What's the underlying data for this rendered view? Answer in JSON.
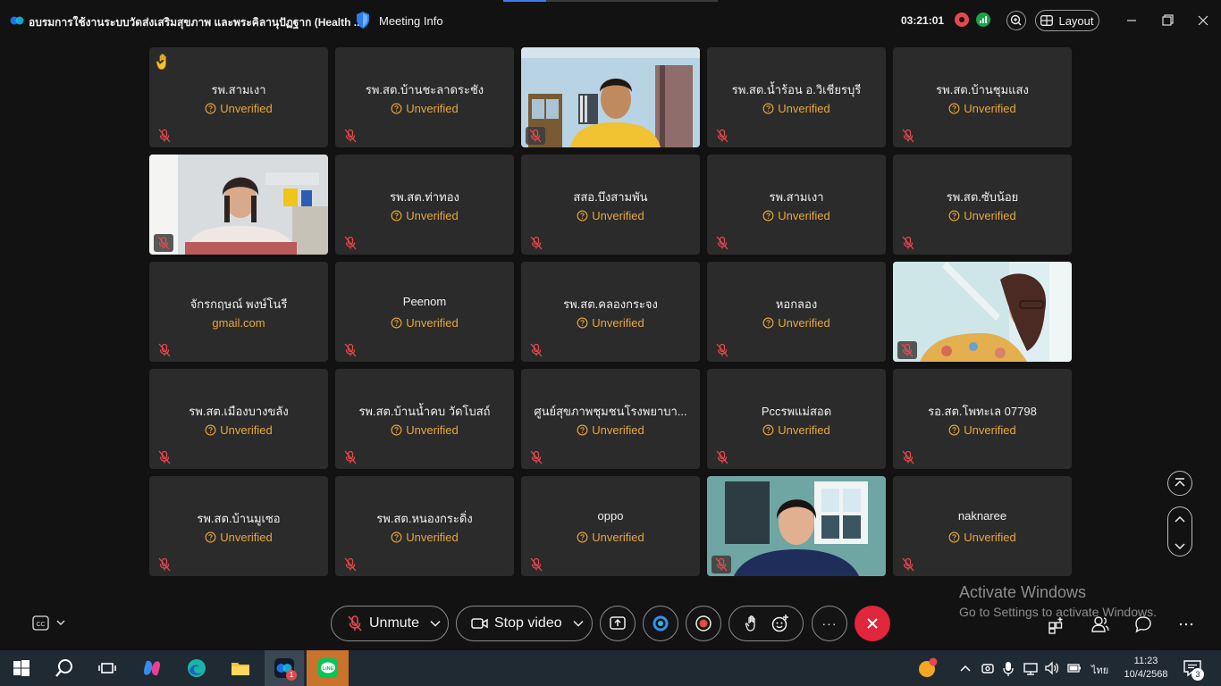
{
  "titlebar": {
    "meeting_title": "อบรมการใช้งานระบบวัดส่งเสริมสุขภาพ และพระคิลานุปัฏฐาก (Health ...",
    "meeting_info": "Meeting Info",
    "timer": "03:21:01",
    "layout_label": "Layout"
  },
  "tiles": [
    {
      "name": "รพ.สามเงา",
      "status": "Unverified",
      "hand": true
    },
    {
      "name": "รพ.สต.บ้านชะลาดระชัง",
      "status": "Unverified"
    },
    {
      "video": true
    },
    {
      "name": "รพ.สต.น้ำร้อน อ.วิเชียรบุรี",
      "status": "Unverified"
    },
    {
      "name": "รพ.สต.บ้านชุมแสง",
      "status": "Unverified"
    },
    {
      "video": true
    },
    {
      "name": "รพ.สต.ท่าทอง",
      "status": "Unverified"
    },
    {
      "name": "สสอ.บึงสามพัน",
      "status": "Unverified"
    },
    {
      "name": "รพ.สามเงา",
      "status": "Unverified"
    },
    {
      "name": "รพ.สต.ซับน้อย",
      "status": "Unverified"
    },
    {
      "name": "จักรกฤษณ์ พงษ์โนรี",
      "status": "gmail.com",
      "plain": true
    },
    {
      "name": "Peenom",
      "status": "Unverified"
    },
    {
      "name": "รพ.สต.คลองกระจง",
      "status": "Unverified"
    },
    {
      "name": "หอกลอง",
      "status": "Unverified"
    },
    {
      "video": true
    },
    {
      "name": "รพ.สต.เมืองบางขลัง",
      "status": "Unverified"
    },
    {
      "name": "รพ.สต.บ้านน้ำคบ วัดโบสถ์",
      "status": "Unverified"
    },
    {
      "name": "ศูนย์สุขภาพชุมชนโรงพยาบา...",
      "status": "Unverified"
    },
    {
      "name": "Pccรพแม่สอด",
      "status": "Unverified"
    },
    {
      "name": "รอ.สต.โพทะเล 07798",
      "status": "Unverified"
    },
    {
      "name": "รพ.สต.บ้านมูเซอ",
      "status": "Unverified"
    },
    {
      "name": "รพ.สต.หนองกระดิ่ง",
      "status": "Unverified"
    },
    {
      "name": "oppo",
      "status": "Unverified"
    },
    {
      "video": true
    },
    {
      "name": "naknaree",
      "status": "Unverified"
    }
  ],
  "controls": {
    "unmute_label": "Unmute",
    "stop_video_label": "Stop video",
    "more_label": "···"
  },
  "watermark": {
    "line1": "Activate Windows",
    "line2": "Go to Settings to activate Windows."
  },
  "taskbar": {
    "time": "11:23",
    "date": "10/4/2568",
    "language": "ไทย",
    "notification_count": "3",
    "webex_badge": "1"
  },
  "colors": {
    "accent_warning": "#e8a73b",
    "end_call": "#e1253a",
    "tile_bg": "#2b2b2b"
  }
}
